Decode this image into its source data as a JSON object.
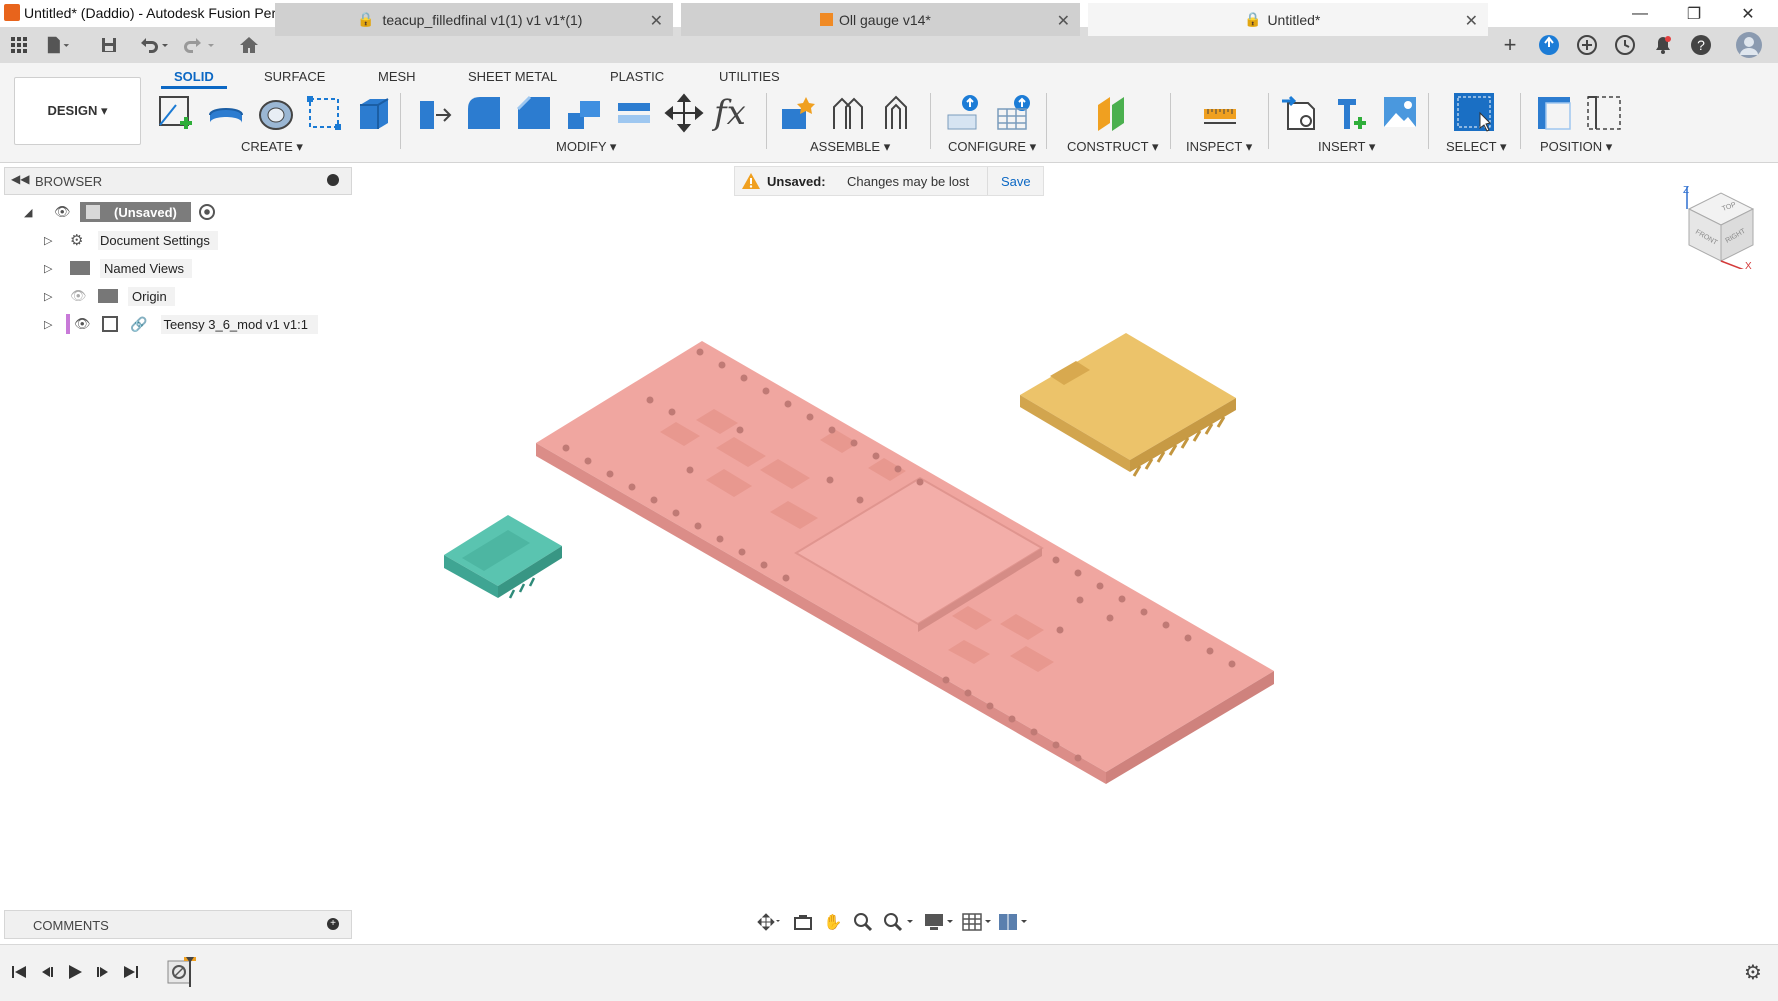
{
  "window": {
    "title": "Untitled* (Daddio) - Autodesk Fusion Personal (Not for Commercial Use)",
    "minimize": "—",
    "restore": "❐",
    "close": "✕"
  },
  "doc_tabs": [
    {
      "label": "teacup_filledfinal v1(1) v1 v1*(1)",
      "close": "✕"
    },
    {
      "label": "Oll gauge v14*",
      "close": "✕"
    },
    {
      "label": "Untitled*",
      "close": "✕"
    }
  ],
  "toolbar": {
    "workspace": "DESIGN ▾",
    "tabs": [
      "SOLID",
      "SURFACE",
      "MESH",
      "SHEET METAL",
      "PLASTIC",
      "UTILITIES"
    ],
    "groups": [
      "CREATE ▾",
      "MODIFY ▾",
      "ASSEMBLE ▾",
      "CONFIGURE ▾",
      "CONSTRUCT ▾",
      "INSPECT ▾",
      "INSERT ▾",
      "SELECT ▾",
      "POSITION ▾"
    ],
    "fx": "fx"
  },
  "browser": {
    "title": "BROWSER",
    "root": "(Unsaved)",
    "items": [
      "Document Settings",
      "Named Views",
      "Origin",
      "Teensy 3_6_mod v1 v1:1"
    ]
  },
  "banner": {
    "label": "Unsaved:",
    "message": "Changes may be lost",
    "save": "Save"
  },
  "viewcube": {
    "top": "TOP",
    "front": "FRONT",
    "right": "RIGHT",
    "z": "Z",
    "x": "X"
  },
  "comments": {
    "title": "COMMENTS"
  },
  "colors": {
    "accent": "#0c68c4",
    "board": "#eea7a1",
    "connector": "#eac369",
    "usb": "#55c2ae",
    "warning": "#f0a020"
  }
}
